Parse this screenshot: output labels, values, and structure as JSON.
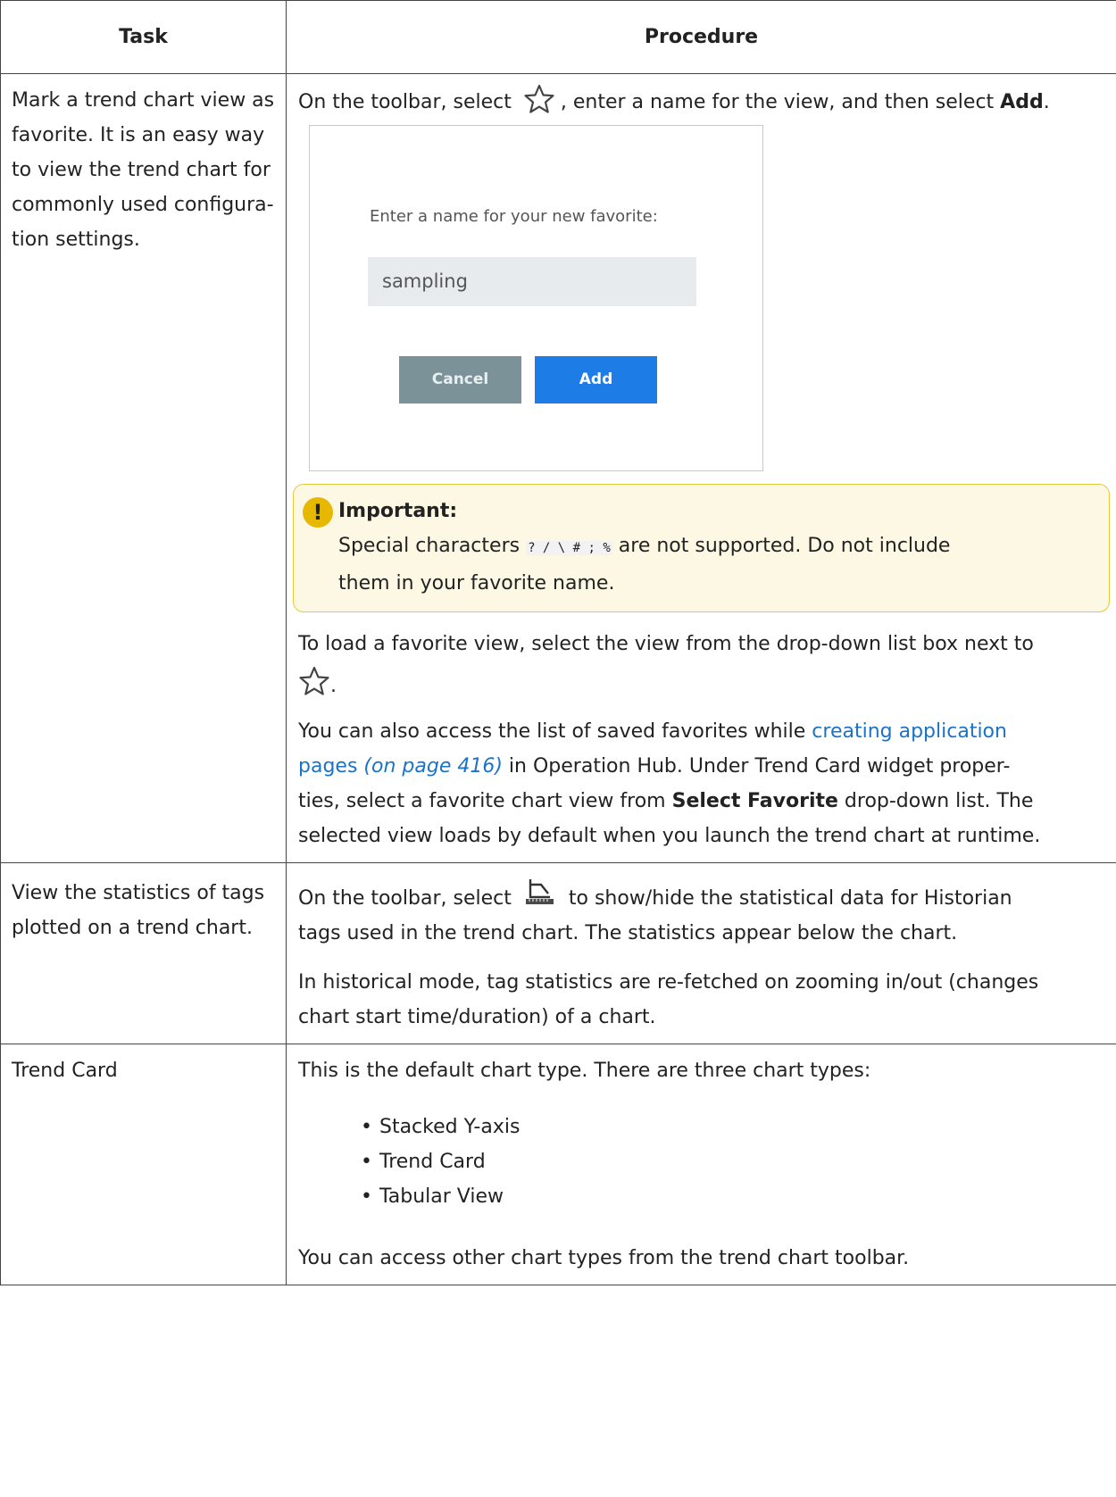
{
  "table": {
    "headers": {
      "task": "Task",
      "procedure": "Procedure"
    },
    "row1": {
      "task_lines": [
        "Mark a trend chart view as",
        "favorite. It is an easy way",
        "to view the trend chart for",
        "commonly used configura-",
        "tion settings."
      ],
      "toolbar_prefix": "On the toolbar, select",
      "toolbar_suffix": ", enter a name for the view, and then select",
      "toolbar_add": "Add",
      "dialog": {
        "prompt": "Enter a name for your new favorite:",
        "input_value": "sampling",
        "cancel": "Cancel",
        "add": "Add"
      },
      "important": {
        "title": "Important:",
        "text_before": "Special characters",
        "chars": "? / \\ # ; %",
        "text_after": "are not supported. Do not include",
        "line2": "them in your favorite name."
      },
      "load_text": "To load a favorite view, select the view from the drop-down list box next to",
      "load_after_icon": ".",
      "access_prefix": "You can also access the list of saved favorites while",
      "access_link": "creating application",
      "access_link2": "pages",
      "access_ref": "(on page 416)",
      "access_mid": "in Operation Hub. Under Trend Card widget proper-",
      "access_line3a": "ties, select a favorite chart view from",
      "access_bold": "Select Favorite",
      "access_line3b": "drop-down list. The",
      "access_line4": "selected view loads by default when you launch the trend chart at runtime."
    },
    "row2": {
      "task_lines": [
        "View the statistics of tags",
        "plotted on a trend chart."
      ],
      "toolbar_prefix": "On the toolbar, select",
      "toolbar_suffix": "to show/hide the statistical data for Historian",
      "line2": "tags used in the trend chart. The statistics appear below the chart.",
      "hist_line1": "In historical mode, tag statistics are re-fetched on zooming in/out (changes",
      "hist_line2": "chart start time/duration) of a chart."
    },
    "row3": {
      "task": "Trend Card",
      "intro": "This is the default chart type. There are three chart types:",
      "types": [
        "Stacked Y-axis",
        "Trend Card",
        "Tabular View"
      ],
      "outro": "You can access other chart types from the trend chart toolbar."
    }
  },
  "icons": {
    "favorite": "star-outline-icon",
    "statistics": "statistics-ruler-icon"
  }
}
